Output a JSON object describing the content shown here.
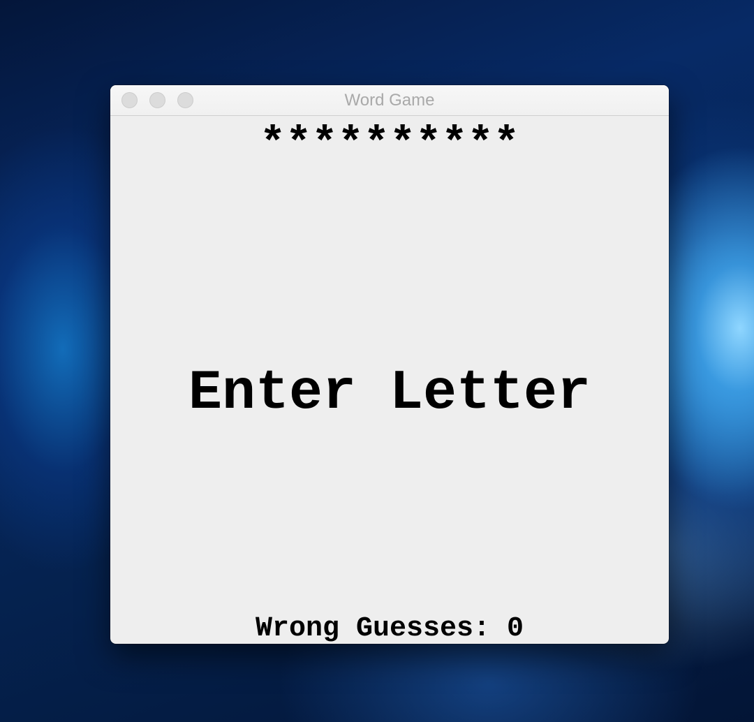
{
  "window": {
    "title": "Word Game"
  },
  "game": {
    "masked_word": "**********",
    "prompt": "Enter Letter",
    "wrong_guesses_label": "Wrong Guesses: 0",
    "wrong_guesses_count": 0
  },
  "colors": {
    "window_background": "#eeeeee",
    "text": "#000000",
    "title_text": "#a9a9a9",
    "traffic_light_inactive": "#dcdcdc"
  }
}
